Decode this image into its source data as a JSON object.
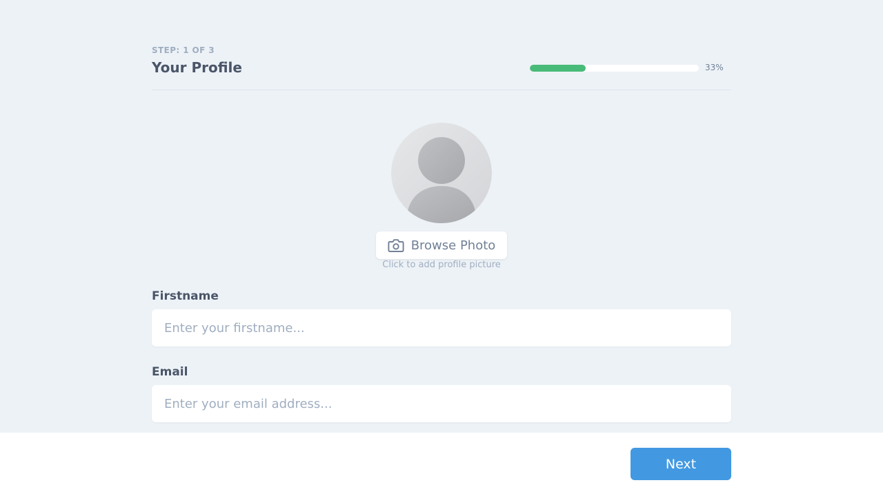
{
  "header": {
    "step_label": "STEP: 1 OF 3",
    "title": "Your Profile",
    "progress_percent": 33,
    "progress_text": "33%"
  },
  "photo": {
    "icon": "camera-icon",
    "browse_label": "Browse Photo",
    "hint": "Click to add profile picture"
  },
  "form": {
    "firstname": {
      "label": "Firstname",
      "value": "",
      "placeholder": "Enter your firstname..."
    },
    "email": {
      "label": "Email",
      "value": "",
      "placeholder": "Enter your email address..."
    }
  },
  "footer": {
    "next_label": "Next"
  },
  "colors": {
    "background": "#edf2f7",
    "progress": "#48bb78",
    "primary": "#4299e1",
    "text": "#4a5568",
    "muted": "#a0aec0"
  }
}
